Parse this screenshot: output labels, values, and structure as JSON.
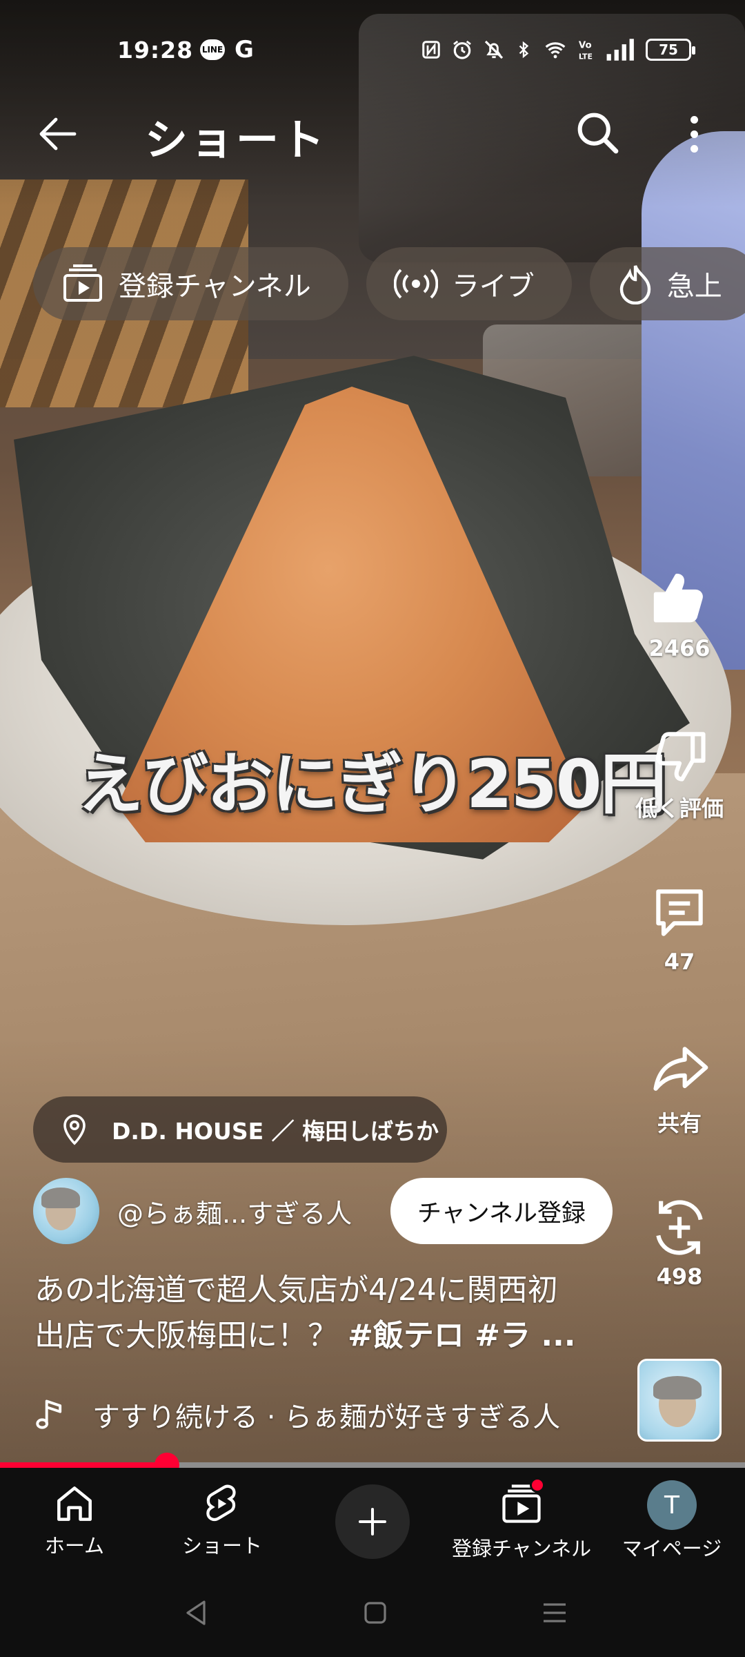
{
  "status_bar": {
    "time": "19:28",
    "left_icons": [
      "line-icon",
      "google-icon"
    ],
    "right_icons": [
      "nfc-icon",
      "alarm-icon",
      "mute-icon",
      "bluetooth-icon",
      "wifi-icon",
      "volte-icon",
      "signal-icon"
    ],
    "battery_level": "75"
  },
  "header": {
    "title": "ショート",
    "back_icon": "back-arrow-icon",
    "search_icon": "search-icon",
    "more_icon": "more-vert-icon"
  },
  "chips": [
    {
      "label": "登録チャンネル",
      "icon": "subscriptions-icon"
    },
    {
      "label": "ライブ",
      "icon": "live-icon"
    },
    {
      "label": "急上",
      "icon": "trending-icon"
    }
  ],
  "video": {
    "overlay_caption": "えびおにぎり250円"
  },
  "actions": {
    "like_count": "2466",
    "dislike_label": "低く評価",
    "comment_count": "47",
    "share_label": "共有",
    "remix_count": "498"
  },
  "location": {
    "text": "D.D. HOUSE ／ 梅田しばちか"
  },
  "channel": {
    "handle": "@らぁ麺...すぎる人",
    "subscribe_label": "チャンネル登録"
  },
  "description": {
    "line1": "あの北海道で超人気店が4/24に関西初",
    "line2_text": "出店で大阪梅田に！？ ",
    "line2_tags": "#飯テロ #ラ ..."
  },
  "music": {
    "text": "すすり続ける · らぁ麺が好きすぎる人"
  },
  "progress": {
    "fraction": 0.224
  },
  "bottom_nav": {
    "home": "ホーム",
    "shorts": "ショート",
    "subscriptions": "登録チャンネル",
    "me": "マイページ",
    "me_initial": "T"
  },
  "colors": {
    "accent": "#ff0033",
    "nav_bg": "#0f0f0f"
  }
}
